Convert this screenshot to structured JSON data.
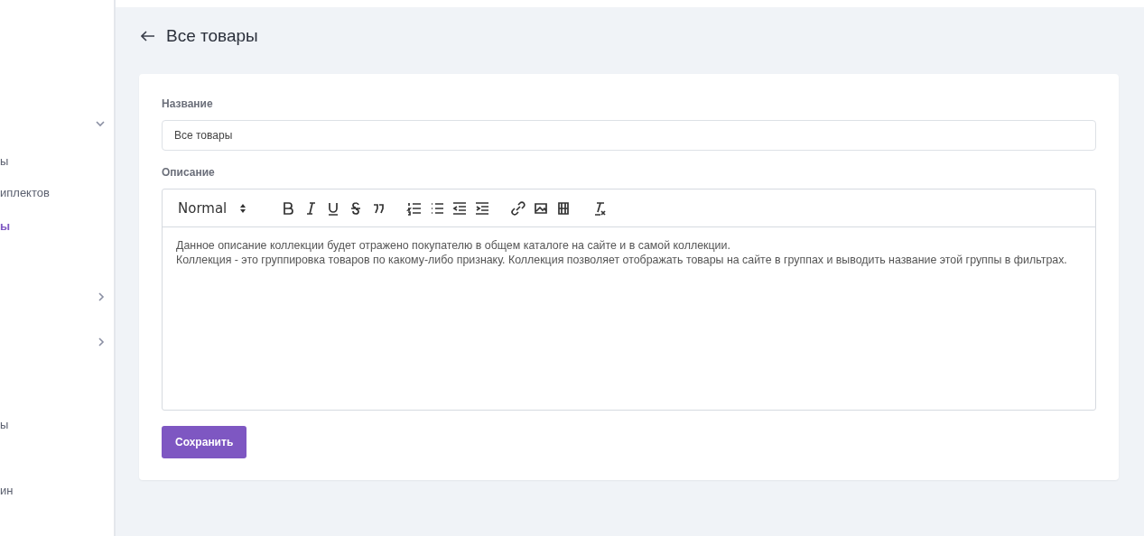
{
  "sidebar": {
    "items": [
      {
        "expanded": true
      },
      {
        "text": "ы",
        "selected": false
      },
      {
        "text": "иплектов",
        "selected": false
      },
      {
        "text": "ы",
        "selected": true
      },
      {
        "expanded": false
      },
      {
        "expanded": false
      },
      {
        "text": "ы",
        "selected": false
      },
      {
        "text": "ин",
        "selected": false
      }
    ]
  },
  "page": {
    "title": "Все товары"
  },
  "form": {
    "name_label": "Название",
    "name_value": "Все товары",
    "description_label": "Описание",
    "editor": {
      "format": "Normal",
      "paragraphs": [
        "Данное описание коллекции будет отражено покупателю в общем каталоге на сайте и в самой коллекции.",
        "Коллекция - это группировка товаров по какому-либо признаку. Коллекция позволяет отображать товары на сайте в группах и выводить название этой группы в фильтрах."
      ]
    },
    "save_button": "Сохранить"
  }
}
